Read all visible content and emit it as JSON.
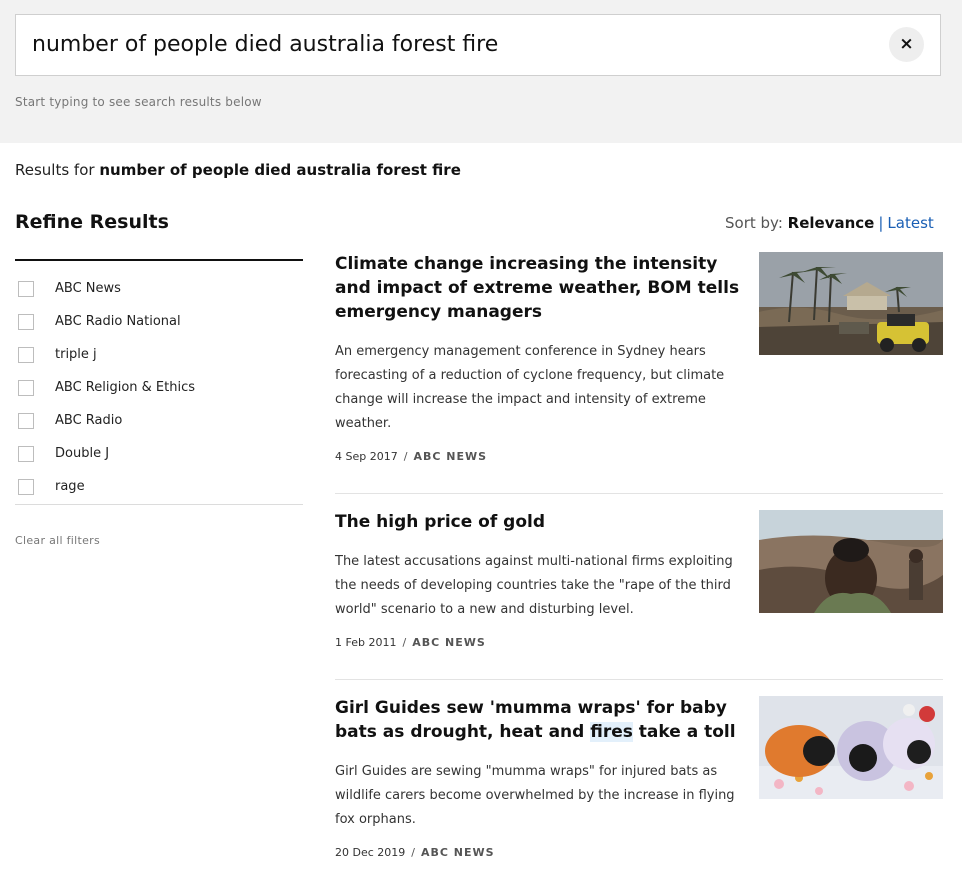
{
  "search": {
    "query": "number of people died australia forest fire",
    "hint": "Start typing to see search results below",
    "clear_icon": "×"
  },
  "results_header": {
    "prefix": "Results for",
    "query": "number of people died australia forest fire"
  },
  "refine": {
    "title": "Refine Results",
    "filters": [
      {
        "label": "ABC News",
        "checked": false
      },
      {
        "label": "ABC Radio National",
        "checked": false
      },
      {
        "label": "triple j",
        "checked": false
      },
      {
        "label": "ABC Religion & Ethics",
        "checked": false
      },
      {
        "label": "ABC Radio",
        "checked": false
      },
      {
        "label": "Double J",
        "checked": false
      },
      {
        "label": "rage",
        "checked": false
      }
    ],
    "clear_all": "Clear all filters"
  },
  "sort": {
    "label": "Sort by:",
    "relevance": "Relevance",
    "separator": "|",
    "latest": "Latest"
  },
  "articles": [
    {
      "title": "Climate change increasing the intensity and impact of extreme weather, BOM tells emergency managers",
      "summary": "An emergency management conference in Sydney hears forecasting of a reduction of cyclone frequency, but climate change will increase the impact and intensity of extreme weather.",
      "date": "4 Sep 2017",
      "source": "ABC NEWS"
    },
    {
      "title": "The high price of gold",
      "summary": "The latest accusations against multi-national firms exploiting the needs of developing countries take the \"rape of the third world\" scenario to a new and disturbing level.",
      "date": "1 Feb 2011",
      "source": "ABC NEWS"
    },
    {
      "title_before": "Girl Guides sew 'mumma wraps' for baby bats as drought, heat and ",
      "title_highlight": "fires",
      "title_after": " take a toll",
      "summary": "Girl Guides are sewing \"mumma wraps\" for injured bats as wildlife carers become overwhelmed by the increase in flying fox orphans.",
      "date": "20 Dec 2019",
      "source": "ABC NEWS"
    }
  ],
  "meta_separator": "/"
}
